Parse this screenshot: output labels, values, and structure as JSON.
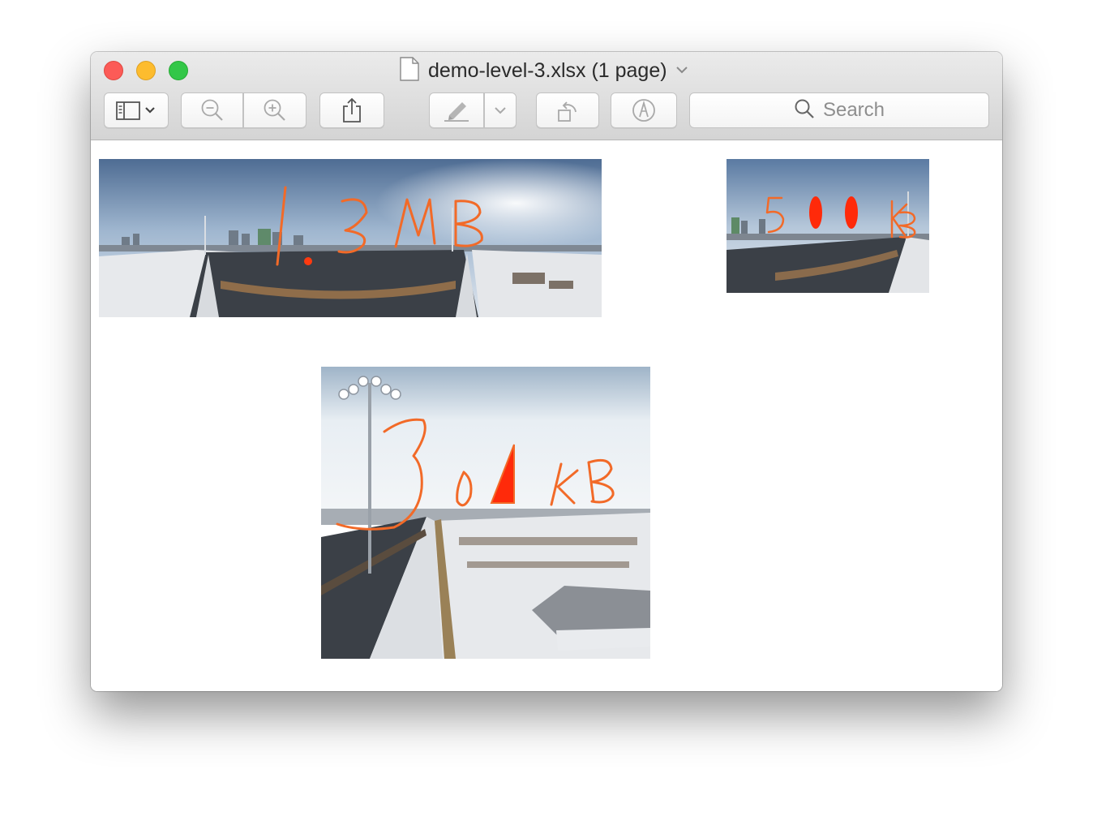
{
  "window": {
    "title": "demo-level-3.xlsx (1 page)"
  },
  "toolbar": {
    "search_placeholder": "Search",
    "buttons": [
      "sidebar-toggle",
      "zoom-out",
      "zoom-in",
      "share",
      "highlight",
      "highlight-options",
      "rotate",
      "markup"
    ]
  },
  "images": [
    {
      "name": "panorama-large",
      "annotation": "1.3MB"
    },
    {
      "name": "panorama-small",
      "annotation": "500KB"
    },
    {
      "name": "square-photo",
      "annotation": "30KB"
    }
  ],
  "colors": {
    "close": "#fc5b57",
    "minimize": "#fdbc2e",
    "maximize": "#33c748",
    "annotation": "#f26a28",
    "annotation_fill": "#ff2a0a"
  }
}
